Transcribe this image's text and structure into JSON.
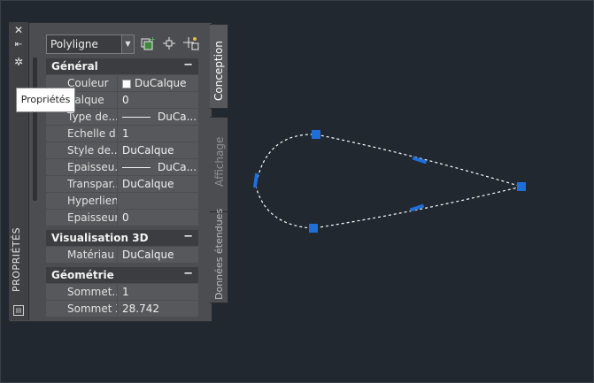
{
  "palette": {
    "title": "PROPRIÉTÉS",
    "titlebar_icons": [
      "close-icon",
      "auto-hide-icon",
      "settings-icon"
    ]
  },
  "tooltip": {
    "text": "Propriétés"
  },
  "toolbar": {
    "object_type": "Polyligne",
    "tools": [
      "quick-select-icon",
      "select-objects-icon",
      "toggle-pickadd-icon"
    ]
  },
  "sections": {
    "general": {
      "title": "Général",
      "toggle": "−",
      "rows": [
        {
          "key": "Couleur",
          "value": "DuCalque"
        },
        {
          "key": "Calque",
          "value": "0"
        },
        {
          "key": "Type de...",
          "value": "DuCa..."
        },
        {
          "key": "Echelle d...",
          "value": "1"
        },
        {
          "key": "Style de...",
          "value": "DuCalque"
        },
        {
          "key": "Epaisseu...",
          "value": "DuCa..."
        },
        {
          "key": "Transpar...",
          "value": "DuCalque"
        },
        {
          "key": "Hyperlien",
          "value": ""
        },
        {
          "key": "Epaisseur",
          "value": "0"
        }
      ]
    },
    "visualisation": {
      "title": "Visualisation 3D",
      "toggle": "−",
      "rows": [
        {
          "key": "Matériau",
          "value": "DuCalque"
        }
      ]
    },
    "geometrie": {
      "title": "Géométrie",
      "toggle": "−",
      "rows": [
        {
          "key": "Sommet...",
          "value": "1"
        },
        {
          "key": "Sommet X",
          "value": "28.742"
        }
      ]
    }
  },
  "tabs": {
    "conception": "Conception",
    "affichage": "Affichage",
    "donnees": "Données étendues"
  },
  "colors": {
    "background": "#212830",
    "grip": "#1e6fd9",
    "polyline": "#ffffff"
  }
}
